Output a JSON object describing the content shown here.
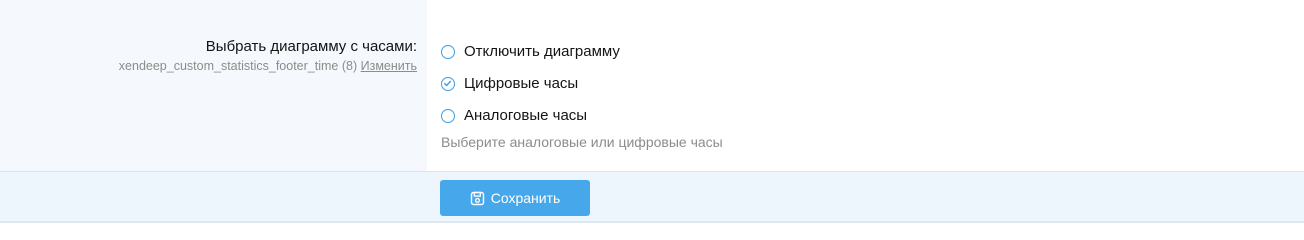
{
  "option": {
    "title": "Выбрать диаграмму с часами:",
    "option_id": "xendeep_custom_statistics_footer_time",
    "display_order": "(8)",
    "edit_link": "Изменить",
    "choices": [
      {
        "label": "Отключить диаграмму",
        "selected": false
      },
      {
        "label": "Цифровые часы",
        "selected": true
      },
      {
        "label": "Аналоговые часы",
        "selected": false
      }
    ],
    "hint": "Выберите аналоговые или цифровые часы"
  },
  "footer": {
    "save_label": "Сохранить",
    "save_icon": "save-icon"
  },
  "colors": {
    "accent": "#47a7eb",
    "radio_border": "#3d9ee7",
    "label_background": "#f5f8fc",
    "footer_background": "#edf6fd"
  }
}
